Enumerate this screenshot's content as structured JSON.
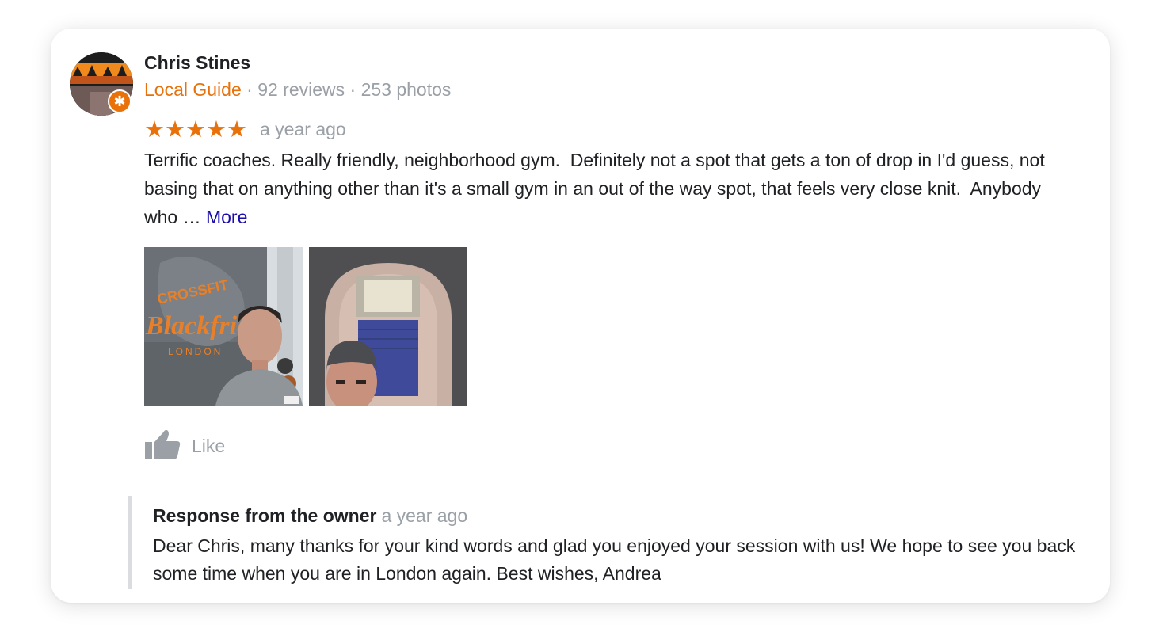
{
  "reviewer": {
    "name": "Chris Stines",
    "guide_label": "Local Guide",
    "stats": " · 92 reviews · 253 photos",
    "badge_icon": "local-guide-star-icon"
  },
  "review": {
    "stars": "★★★★★",
    "rating": 5,
    "date": "a year ago",
    "text": "Terrific coaches. Really friendly, neighborhood gym.  Definitely not a spot that gets a ton of drop in I'd guess, not basing that on anything other than it's a small gym in an out of the way spot, that feels very close knit.  Anybody who … ",
    "more_label": "More"
  },
  "photos": {
    "photo1_sign_line1": "CROSSFIT",
    "photo1_sign_line2": "Blackfriars",
    "photo1_sign_line3": "LONDON"
  },
  "actions": {
    "like_label": "Like"
  },
  "owner_response": {
    "title": "Response from the owner",
    "date": "a year ago",
    "text": "Dear Chris, many thanks for your kind words and glad you enjoyed your session with us! We hope to see you back some time when you are in London again. Best wishes, Andrea"
  },
  "colors": {
    "accent": "#e8710a",
    "link": "#1a0dab",
    "muted": "#9aa0a6",
    "text": "#202124"
  }
}
